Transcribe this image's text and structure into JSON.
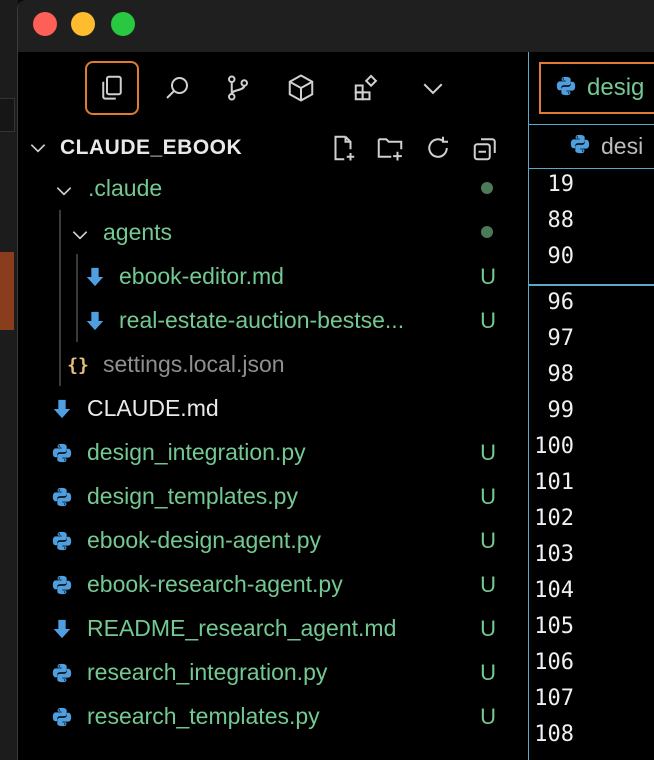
{
  "explorer": {
    "project_title": "CLAUDE_EBOOK",
    "tree": [
      {
        "label": "design_integration.py",
        "badge": "U"
      }
    ],
    "items": [
      {
        "label": ".claude",
        "status": "dot"
      },
      {
        "label": "agents",
        "status": "dot"
      },
      {
        "label": "ebook-editor.md",
        "badge": "U"
      },
      {
        "label": "real-estate-auction-bestse...",
        "badge": "U"
      },
      {
        "label": "settings.local.json"
      },
      {
        "label": "CLAUDE.md"
      },
      {
        "label": "design_integration.py",
        "badge": "U"
      },
      {
        "label": "design_templates.py",
        "badge": "U"
      },
      {
        "label": "ebook-design-agent.py",
        "badge": "U"
      },
      {
        "label": "ebook-research-agent.py",
        "badge": "U"
      },
      {
        "label": "README_research_agent.md",
        "badge": "U"
      },
      {
        "label": "research_integration.py",
        "badge": "U"
      },
      {
        "label": "research_templates.py",
        "badge": "U"
      }
    ]
  },
  "editor": {
    "tab_label": "desig",
    "breadcrumb_label": "desi",
    "sticky_lines": [
      "19",
      "88",
      "90"
    ],
    "lines": [
      "96",
      "97",
      "98",
      "99",
      "100",
      "101",
      "102",
      "103",
      "104",
      "105",
      "106",
      "107",
      "108"
    ]
  },
  "colors": {
    "accent_orange": "#e07b32",
    "git_untracked_green": "#73c991",
    "focus_blue": "#5aa9c9"
  }
}
